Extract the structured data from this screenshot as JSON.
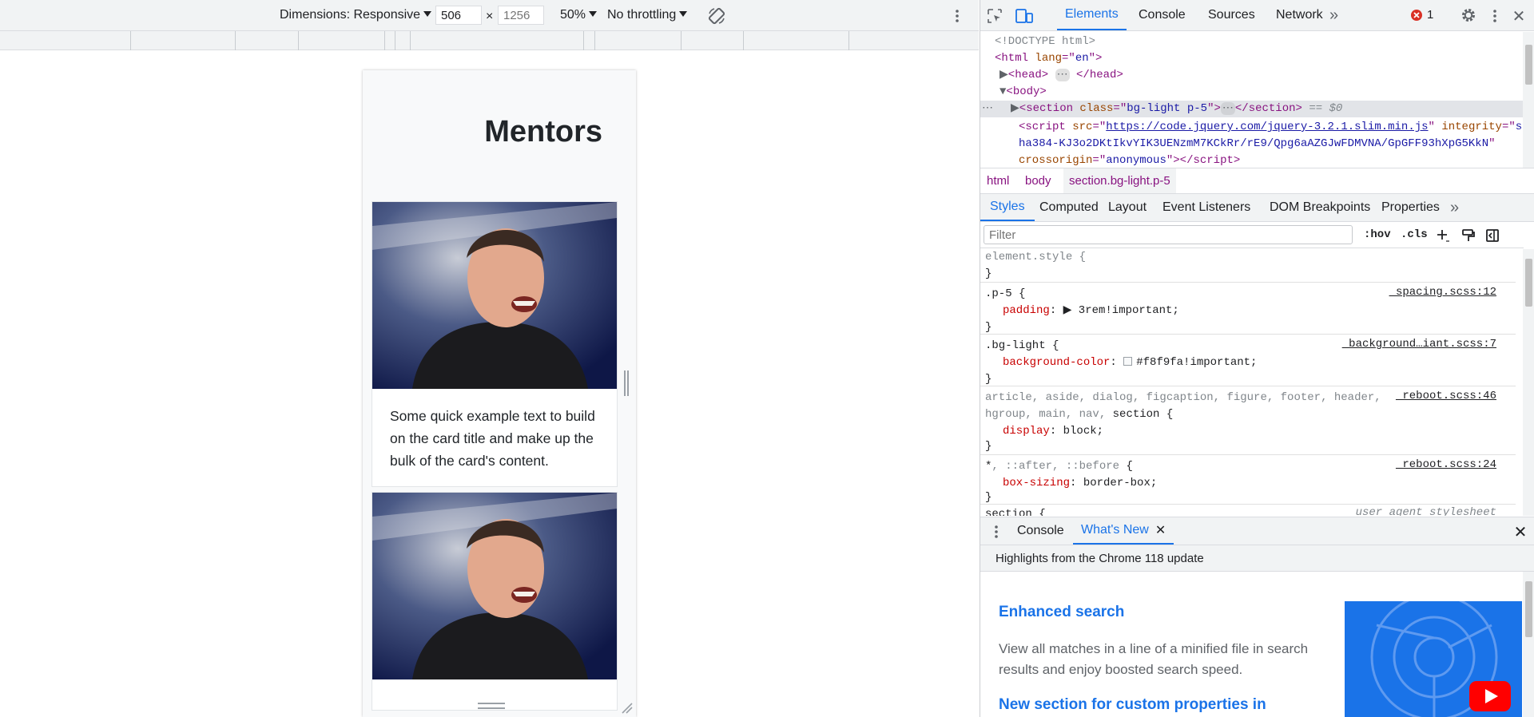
{
  "device_toolbar": {
    "dimensions_label": "Dimensions: Responsive",
    "width_value": "506",
    "times": "×",
    "height_placeholder": "1256",
    "zoom": "50%",
    "throttling": "No throttling"
  },
  "page": {
    "title": "Mentors",
    "cards": [
      {
        "text": "Some quick example text to build on the card title and make up the bulk of the card's content."
      },
      {
        "text": ""
      }
    ]
  },
  "devtools": {
    "tabs": [
      "Elements",
      "Console",
      "Sources",
      "Network"
    ],
    "more": "»",
    "error_count": "1",
    "dom": {
      "doctype": "<!DOCTYPE html>",
      "html_open_tag": "html",
      "html_attr": "lang",
      "html_attr_val": "en",
      "head_tag": "head",
      "body_tag": "body",
      "section_tag": "section",
      "section_attr": "class",
      "section_class": "bg-light p-5",
      "eq": "== $0",
      "script_tag": "script",
      "script_src_attr": "src",
      "script_src": "https://code.jquery.com/jquery-3.2.1.slim.min.js",
      "integrity_attr": "integrity",
      "integrity_1": "s",
      "integrity_2": "ha384-KJ3o2DKtIkvYIK3UENzmM7KCkRr/rE9/Qpg6aAZGJwFDMVNA/GpGFF93hXpG5KkN",
      "crossorigin_attr": "crossorigin",
      "crossorigin_val": "anonymous"
    },
    "breadcrumbs": [
      "html",
      "body",
      "section.bg-light.p-5"
    ],
    "sub_tabs": [
      "Styles",
      "Computed",
      "Layout",
      "Event Listeners",
      "DOM Breakpoints",
      "Properties"
    ],
    "filter_placeholder": "Filter",
    "hov": ":hov",
    "cls": ".cls",
    "styles": {
      "element_style": "element.style {",
      "close": "}",
      "p5_selector": ".p-5 {",
      "p5_src": "_spacing.scss:12",
      "p5_prop": "padding",
      "p5_val": "3rem!important;",
      "bg_selector": ".bg-light {",
      "bg_src": "_background…iant.scss:7",
      "bg_prop": "background-color",
      "bg_val": "#f8f9fa!important;",
      "bg_swatch": "#f8f9fa",
      "reboot_sel_1": "article, aside, dialog, figcaption, figure, footer, header,",
      "reboot_sel_2a": "hgroup, main, nav, ",
      "reboot_sel_2b": "section",
      "reboot_sel_2c": " {",
      "reboot_src_1": "_reboot.scss:46",
      "display_prop": "display",
      "display_val": "block;",
      "univ_sel_a": "*",
      "univ_sel_b": ", ::after, ::before",
      "univ_sel_c": " {",
      "univ_src": "_reboot.scss:24",
      "bs_prop": "box-sizing",
      "bs_val": "border-box;",
      "section_sel": "section {",
      "ua_src": "user agent stylesheet"
    },
    "drawer": {
      "tabs": [
        "Console",
        "What's New"
      ],
      "highlights": "Highlights from the Chrome 118 update",
      "h1": "Enhanced search",
      "p1": "View all matches in a line of a minified file in search results and enjoy boosted search speed.",
      "h2": "New section for custom properties in"
    }
  }
}
